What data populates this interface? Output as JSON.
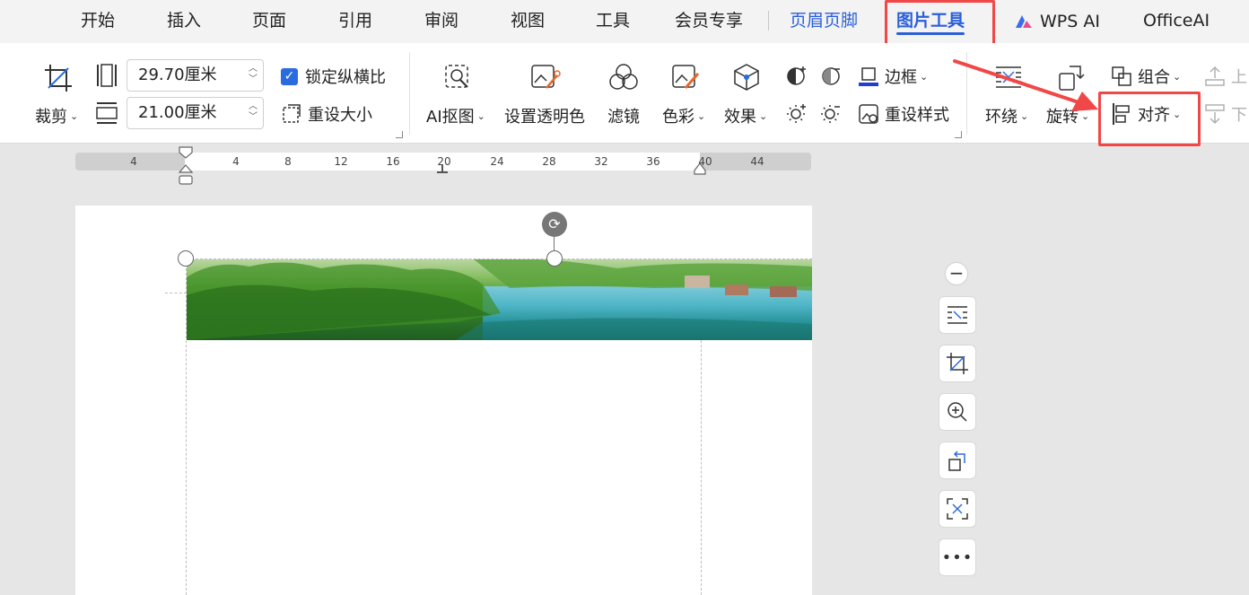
{
  "tabs": {
    "home": "开始",
    "insert": "插入",
    "page": "页面",
    "references": "引用",
    "review": "审阅",
    "view": "视图",
    "tools": "工具",
    "member": "会员专享",
    "header_footer": "页眉页脚",
    "picture_tools": "图片工具",
    "wps_ai": "WPS AI",
    "office_ai": "OfficeAI"
  },
  "ribbon": {
    "crop": "裁剪",
    "width_value": "29.70厘米",
    "height_value": "21.00厘米",
    "lock_aspect": "锁定纵横比",
    "reset_size": "重设大小",
    "ai_cutout": "AI抠图",
    "set_transparent": "设置透明色",
    "filter": "滤镜",
    "color": "色彩",
    "effects": "效果",
    "border": "边框",
    "reset_style": "重设样式",
    "wrap": "环绕",
    "rotate": "旋转",
    "group": "组合",
    "align": "对齐",
    "up": "上",
    "down": "下"
  },
  "ruler": {
    "ticks": [
      "4",
      "4",
      "8",
      "12",
      "16",
      "20",
      "24",
      "28",
      "32",
      "36",
      "40",
      "44"
    ]
  },
  "colors": {
    "accent": "#2b5fd9",
    "highlight": "#f04848",
    "checkbox": "#2b6be0"
  }
}
